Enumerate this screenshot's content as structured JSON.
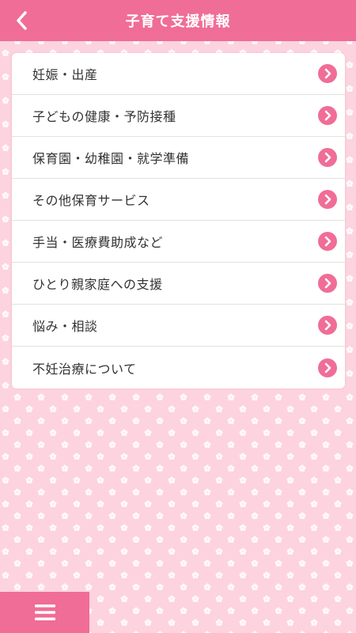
{
  "header": {
    "title": "子育て支援情報",
    "back_icon": "chevron-left-icon"
  },
  "menu": {
    "items": [
      {
        "label": "妊娠・出産"
      },
      {
        "label": "子どもの健康・予防接種"
      },
      {
        "label": "保育園・幼稚園・就学準備"
      },
      {
        "label": "その他保育サービス"
      },
      {
        "label": "手当・医療費助成など"
      },
      {
        "label": "ひとり親家庭への支援"
      },
      {
        "label": "悩み・相談"
      },
      {
        "label": "不妊治療について"
      }
    ],
    "item_icon": "chevron-right-circle-icon"
  },
  "footer": {
    "menu_icon": "hamburger-menu-icon"
  },
  "colors": {
    "accent": "#f06d98",
    "background": "#fcd3df",
    "pattern_flower": "#ffffff",
    "text": "#333333"
  }
}
